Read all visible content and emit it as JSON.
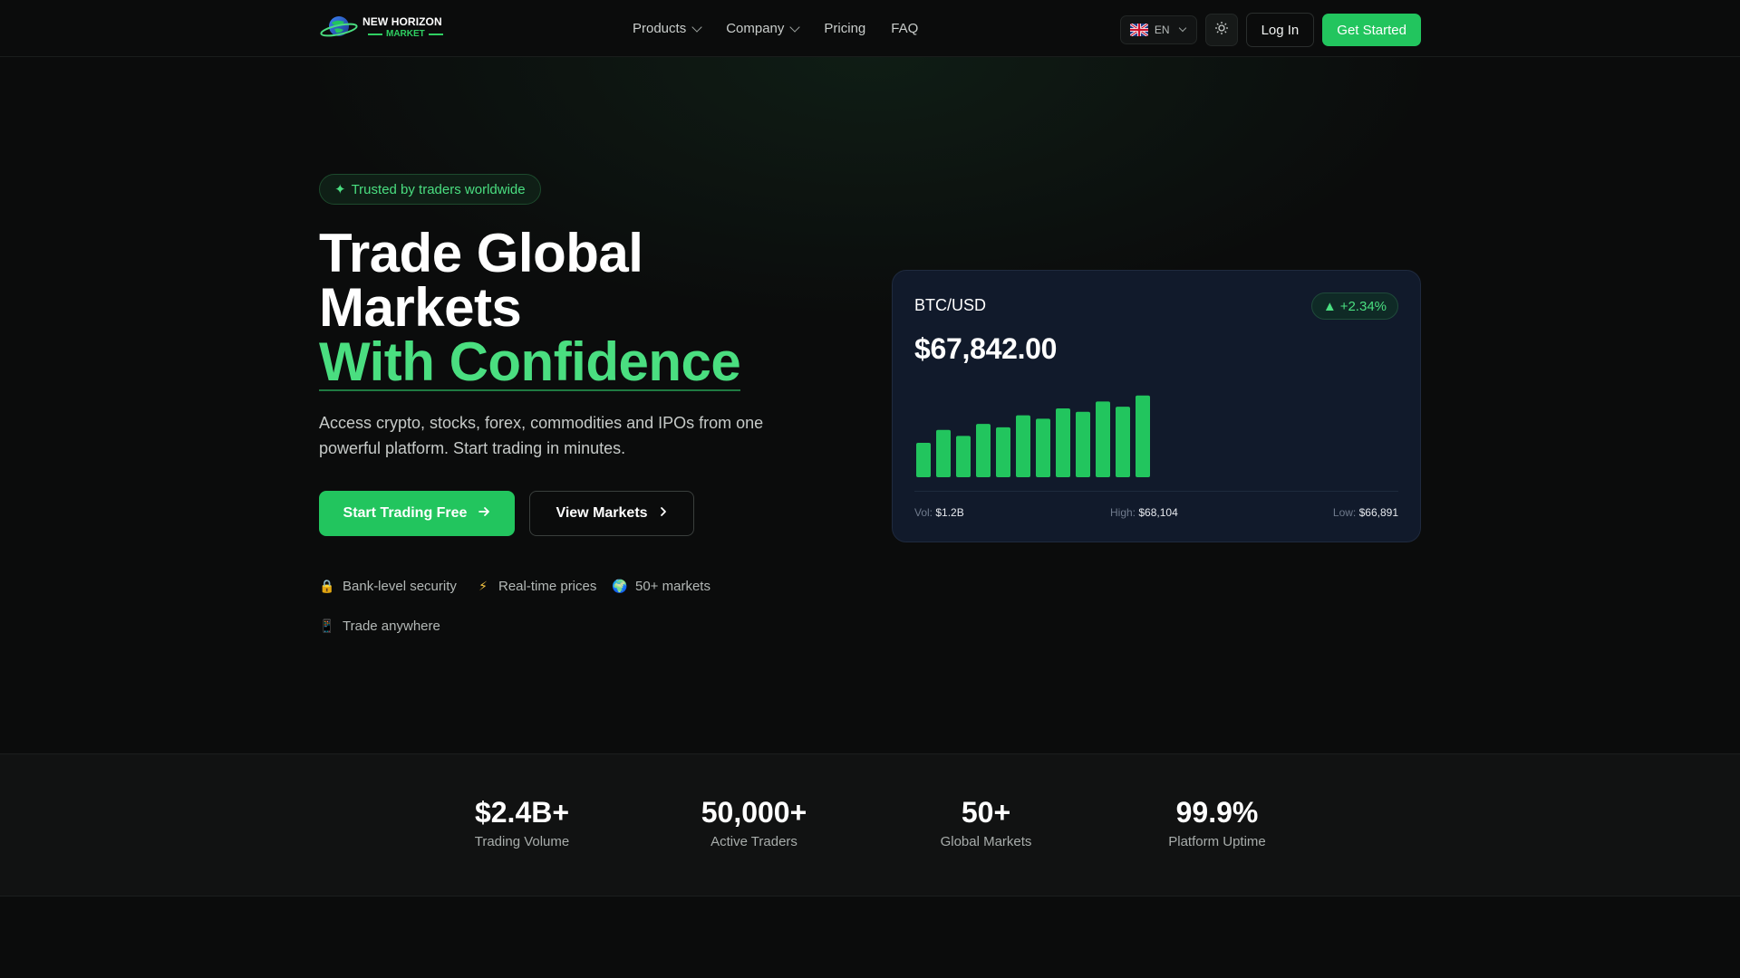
{
  "brand": {
    "name_top": "NEW HORIZON",
    "name_bottom": "MARKET",
    "accent": "#22c55e"
  },
  "nav": {
    "items": [
      {
        "label": "Products",
        "has_dropdown": true
      },
      {
        "label": "Company",
        "has_dropdown": true
      },
      {
        "label": "Pricing",
        "has_dropdown": false
      },
      {
        "label": "FAQ",
        "has_dropdown": false
      }
    ],
    "language": "EN",
    "login_label": "Log In",
    "cta_label": "Get Started"
  },
  "hero": {
    "badge": "Trusted by traders worldwide",
    "title_line1": "Trade Global",
    "title_line2": "Markets",
    "title_line3": "With Confidence",
    "subtitle": "Access crypto, stocks, forex, commodities and IPOs from one powerful platform. Start trading in minutes.",
    "primary_button": "Start Trading Free",
    "secondary_button": "View Markets",
    "features": [
      {
        "icon": "lock-icon",
        "glyph": "🔒",
        "label": "Bank-level security"
      },
      {
        "icon": "lightning-icon",
        "glyph": "⚡",
        "label": "Real-time prices"
      },
      {
        "icon": "globe-icon",
        "glyph": "🌍",
        "label": "50+ markets"
      },
      {
        "icon": "phone-icon",
        "glyph": "📱",
        "label": "Trade anywhere"
      }
    ]
  },
  "ticker_card": {
    "pair": "BTC/USD",
    "change": "+2.34%",
    "price": "$67,842.00",
    "vol_label": "Vol:",
    "vol_value": "$1.2B",
    "high_label": "High:",
    "high_value": "$68,104",
    "low_label": "Low:",
    "low_value": "$66,891"
  },
  "chart_data": {
    "type": "bar",
    "values": [
      40,
      55,
      48,
      62,
      58,
      72,
      68,
      80,
      76,
      88,
      82,
      95
    ],
    "ylim": [
      0,
      100
    ],
    "color": "#22c55e"
  },
  "stats": [
    {
      "value": "$2.4B+",
      "label": "Trading Volume"
    },
    {
      "value": "50,000+",
      "label": "Active Traders"
    },
    {
      "value": "50+",
      "label": "Global Markets"
    },
    {
      "value": "99.9%",
      "label": "Platform Uptime"
    }
  ]
}
